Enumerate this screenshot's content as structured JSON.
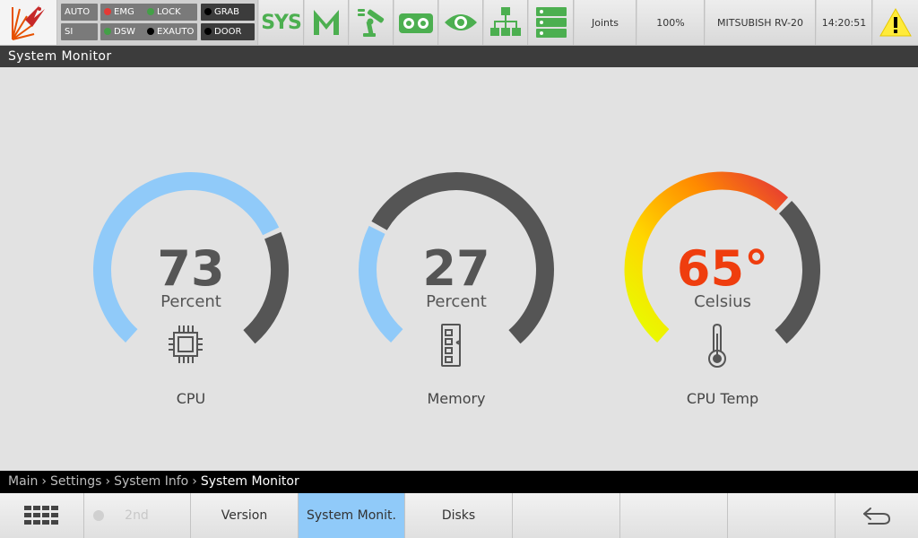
{
  "status_signals": [
    {
      "label": "AUTO",
      "dot": ""
    },
    {
      "label": "SI",
      "dot": ""
    },
    {
      "label": "EMG",
      "dot": "#e53935"
    },
    {
      "label": "DSW",
      "dot": "#43a047"
    },
    {
      "label": "LOCK",
      "dot": "#43a047"
    },
    {
      "label": "EXAUTO",
      "dot": "#000000"
    },
    {
      "label": "GRAB",
      "dot": "#000000"
    },
    {
      "label": "DOOR",
      "dot": "#000000"
    }
  ],
  "toolbar": {
    "sys_label": "SYS",
    "coord_label": "Joints",
    "speed_label": "100%",
    "robot_label": "MITSUBISH RV-20",
    "clock": "14:20:51",
    "accent_green": "#4caf50",
    "warning_color": "#ffeb3b"
  },
  "title": "System Monitor",
  "gauges": {
    "cpu": {
      "value": "73",
      "unit": "Percent",
      "label": "CPU",
      "fraction": 0.73,
      "fill_color": "#90caf9",
      "track_color": "#555555",
      "icon": "cpu-chip-icon"
    },
    "memory": {
      "value": "27",
      "unit": "Percent",
      "label": "Memory",
      "fraction": 0.27,
      "fill_color": "#90caf9",
      "track_color": "#555555",
      "icon": "memory-module-icon"
    },
    "temp": {
      "value": "65°",
      "unit": "Celsius",
      "label": "CPU Temp",
      "fraction": 0.65,
      "fill_color": "gradient",
      "value_color": "#ef3d0e",
      "track_color": "#555555",
      "icon": "thermometer-icon"
    }
  },
  "breadcrumb": {
    "items": [
      "Main",
      "Settings",
      "System Info"
    ],
    "current": "System Monitor"
  },
  "bottom_nav": {
    "menu_icon": "grid-menu-icon",
    "second_label": "2nd",
    "tabs": [
      "Version",
      "System Monit.",
      "Disks"
    ],
    "active_tab": "System Monit.",
    "back_icon": "back-arrow-icon"
  }
}
